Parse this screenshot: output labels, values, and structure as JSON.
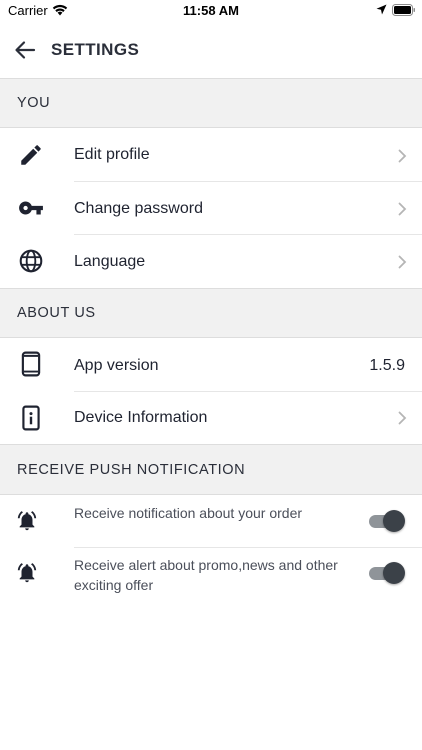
{
  "status_bar": {
    "carrier": "Carrier",
    "time": "11:58 AM",
    "icons": [
      "wifi-icon",
      "location-arrow-icon",
      "battery-icon"
    ]
  },
  "header": {
    "back_icon": "arrow-left-icon",
    "title": "SETTINGS"
  },
  "sections": {
    "you": {
      "title": "YOU",
      "items": [
        {
          "label": "Edit profile",
          "icon": "pencil-icon"
        },
        {
          "label": "Change password",
          "icon": "key-icon"
        },
        {
          "label": "Language",
          "icon": "globe-icon"
        }
      ]
    },
    "about": {
      "title": "ABOUT US",
      "items": [
        {
          "label": "App version",
          "value": "1.5.9",
          "icon": "smartphone-icon"
        },
        {
          "label": "Device Information",
          "icon": "device-info-icon"
        }
      ]
    },
    "push": {
      "title": "RECEIVE PUSH NOTIFICATION",
      "items": [
        {
          "label": "Receive notification about your order",
          "enabled": true,
          "icon": "alarm-bell-icon"
        },
        {
          "label": "Receive alert about promo,news and other exciting offer",
          "enabled": true,
          "icon": "alarm-bell-icon"
        }
      ]
    }
  },
  "colors": {
    "section_bg": "#f1f1f1",
    "toggle_knob": "#3b4148",
    "toggle_track": "#8f9499",
    "text": "#1f2330"
  }
}
